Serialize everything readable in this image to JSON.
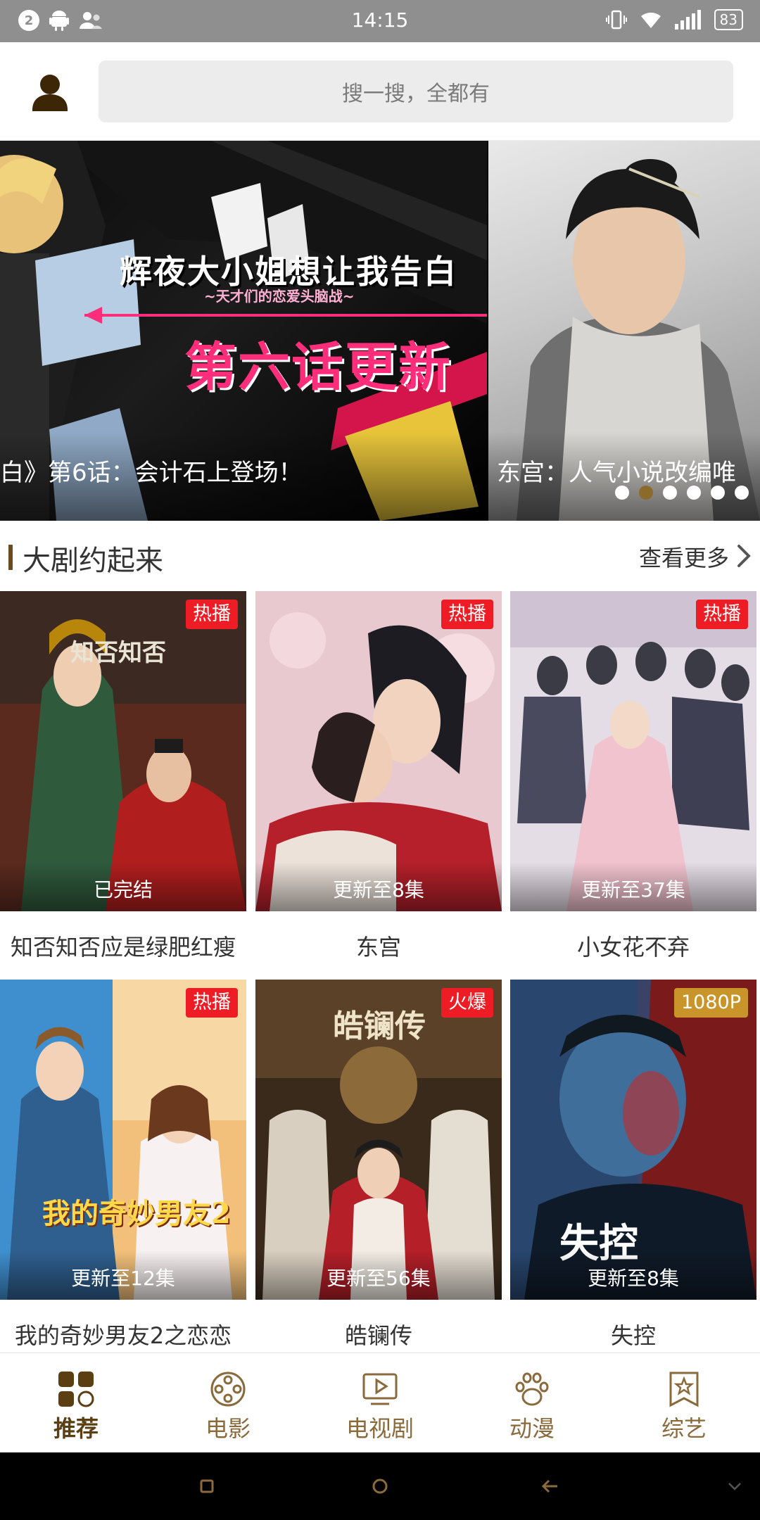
{
  "status_bar": {
    "notification_count": "2",
    "time": "14:15",
    "battery": "83"
  },
  "search": {
    "placeholder": "搜一搜，全都有"
  },
  "banner": {
    "slide1": {
      "title": "辉夜大小姐想让我告白",
      "subtitle": "~天才们的恋爱头脑战~",
      "headline": "第六话更新",
      "caption": "白》第6话：会计石上登场！"
    },
    "slide2": {
      "caption": "东宫：人气小说改编唯"
    },
    "active_dot_index": 1,
    "dot_count": 6
  },
  "section": {
    "title": "大剧约起来",
    "more": "查看更多"
  },
  "shows": [
    {
      "name": "知否知否应是绿肥红瘦",
      "badge": "热播",
      "badge_color": "red",
      "episode": "已完结"
    },
    {
      "name": "东宫",
      "badge": "热播",
      "badge_color": "red",
      "episode": "更新至8集"
    },
    {
      "name": "小女花不弃",
      "badge": "热播",
      "badge_color": "red",
      "episode": "更新至37集"
    },
    {
      "name": "我的奇妙男友2之恋恋",
      "badge": "热播",
      "badge_color": "red",
      "episode": "更新至12集"
    },
    {
      "name": "皓镧传",
      "badge": "火爆",
      "badge_color": "red",
      "episode": "更新至56集"
    },
    {
      "name": "失控",
      "badge": "1080P",
      "badge_color": "gold",
      "episode": "更新至8集"
    }
  ],
  "poster_text": {
    "p1": "知否知否",
    "p4": "我的奇妙男友2",
    "p5": "皓镧传",
    "p6": "失控"
  },
  "bottom_nav": [
    {
      "label": "推荐",
      "icon": "grid-icon",
      "active": true
    },
    {
      "label": "电影",
      "icon": "film-reel-icon",
      "active": false
    },
    {
      "label": "电视剧",
      "icon": "tv-play-icon",
      "active": false
    },
    {
      "label": "动漫",
      "icon": "paw-icon",
      "active": false
    },
    {
      "label": "综艺",
      "icon": "star-badge-icon",
      "active": false
    }
  ],
  "colors": {
    "accent": "#5b3e12",
    "badge_red": "#ee1c25",
    "badge_gold": "#c9952a"
  }
}
